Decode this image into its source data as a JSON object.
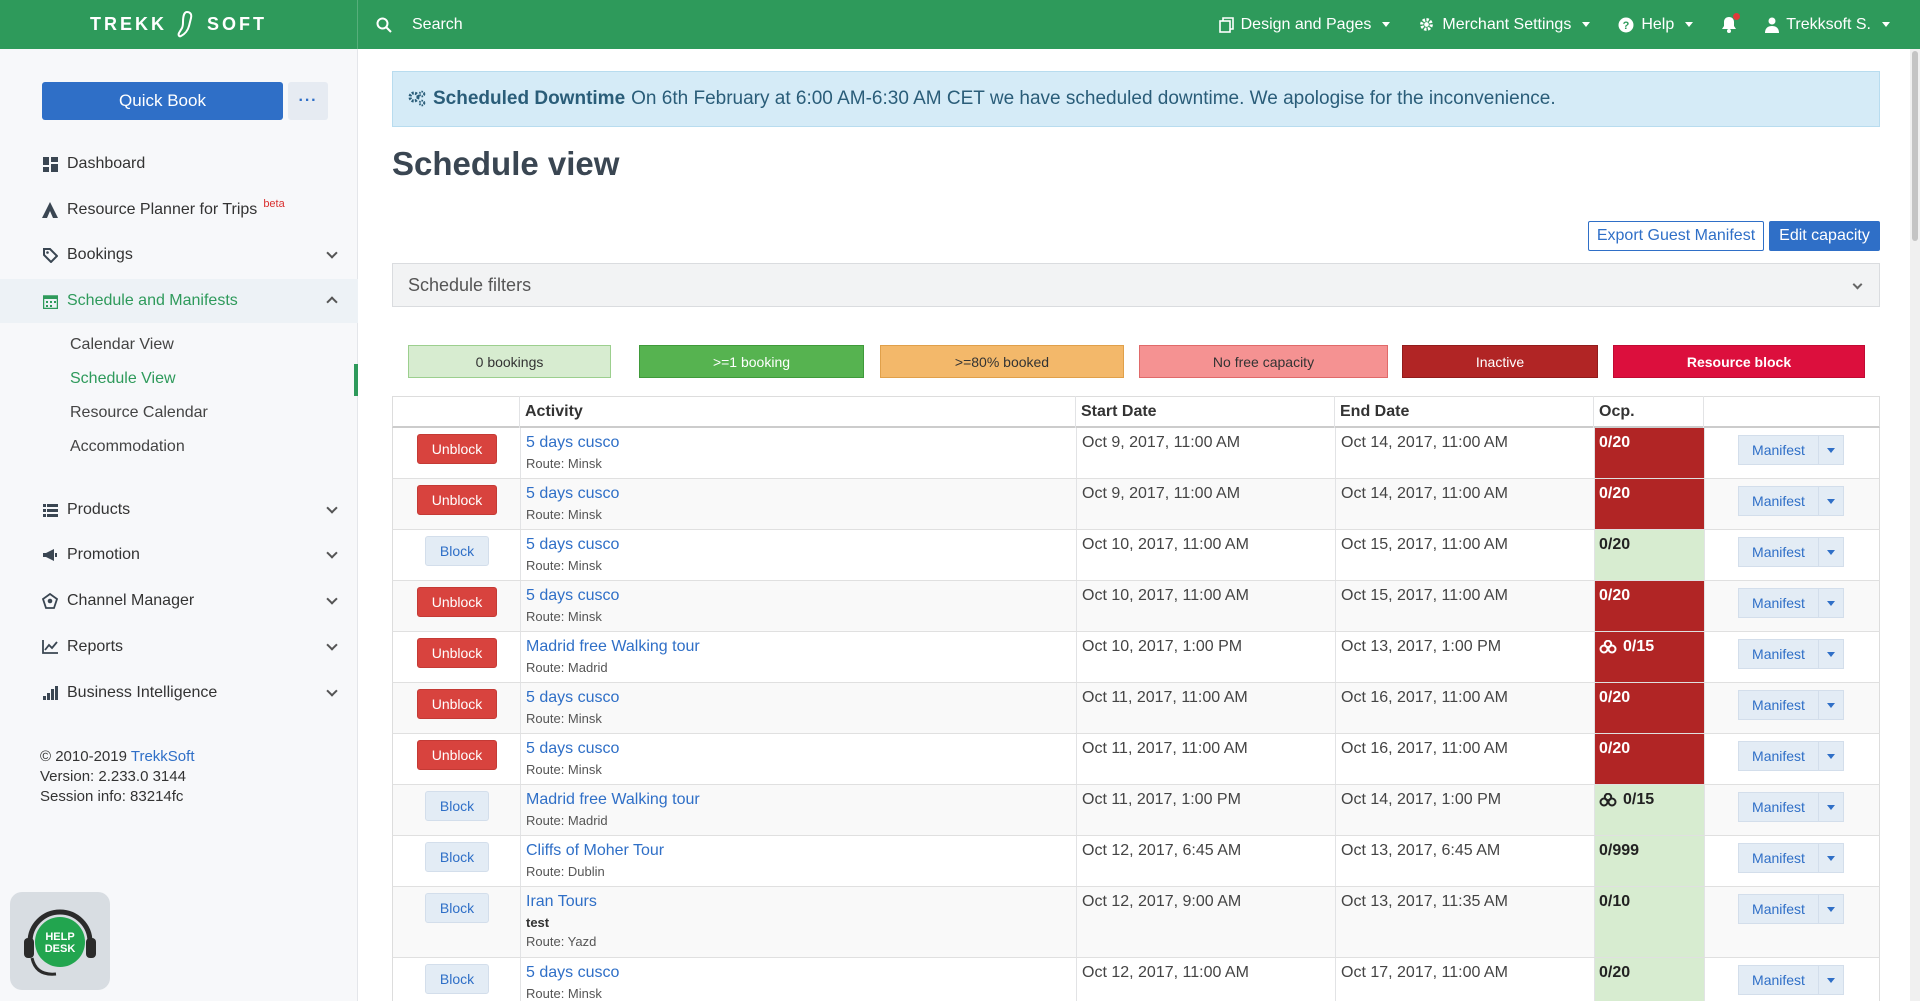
{
  "topbar": {
    "logo_left": "TREKK",
    "logo_right": "SOFT",
    "search_label": "Search",
    "nav": [
      {
        "label": "Design and Pages",
        "icon": "copy-icon"
      },
      {
        "label": "Merchant Settings",
        "icon": "gear-icon"
      },
      {
        "label": "Help",
        "icon": "question-icon"
      },
      {
        "label": "",
        "icon": "bell-icon"
      },
      {
        "label": "Trekksoft S.",
        "icon": "user-icon"
      }
    ]
  },
  "sidebar": {
    "quick_book": "Quick Book",
    "more_label": "···",
    "items": [
      {
        "label": "Dashboard",
        "icon": "dashboard-icon"
      },
      {
        "label": "Resource Planner for Trips",
        "icon": "planner-icon",
        "badge": "beta"
      },
      {
        "label": "Bookings",
        "icon": "tag-icon"
      },
      {
        "label": "Schedule and Manifests",
        "icon": "calendar-icon"
      },
      {
        "label": "Products",
        "icon": "list-icon"
      },
      {
        "label": "Promotion",
        "icon": "megaphone-icon"
      },
      {
        "label": "Channel Manager",
        "icon": "network-icon"
      },
      {
        "label": "Reports",
        "icon": "chart-icon"
      },
      {
        "label": "Business Intelligence",
        "icon": "bars-icon"
      }
    ],
    "subitems": [
      "Calendar View",
      "Schedule View",
      "Resource Calendar",
      "Accommodation"
    ],
    "footer": {
      "copyright": "© 2010-2019 ",
      "company": "TrekkSoft",
      "version": "Version: 2.233.0 3144",
      "session": "Session info: 83214fc"
    },
    "help_desk": "HELP DESK"
  },
  "alert": {
    "title": "Scheduled Downtime",
    "text": "On 6th February at 6:00 AM-6:30 AM CET we have scheduled downtime. We apologise for the inconvenience."
  },
  "page_title": "Schedule view",
  "actions": {
    "export": "Export Guest Manifest",
    "edit": "Edit capacity"
  },
  "filters_label": "Schedule filters",
  "legend": [
    {
      "label": "0 bookings",
      "bg": "#d7ecd0",
      "border": "#9ccf8e",
      "color": "#333",
      "bold": false
    },
    {
      "label": ">=1 booking",
      "bg": "#56b350",
      "border": "#3f9a3a",
      "color": "#fff",
      "bold": false
    },
    {
      "label": ">=80% booked",
      "bg": "#f3b86a",
      "border": "#e0a04a",
      "color": "#333",
      "bold": false
    },
    {
      "label": "No free capacity",
      "bg": "#f59292",
      "border": "#e06a6a",
      "color": "#333",
      "bold": false
    },
    {
      "label": "Inactive",
      "bg": "#b12525",
      "border": "#911c1c",
      "color": "#fff",
      "bold": false
    },
    {
      "label": "Resource block",
      "bg": "#dc0f3d",
      "border": "#c00b33",
      "color": "#fff",
      "bold": true
    }
  ],
  "table": {
    "headers": [
      "",
      "Activity",
      "Start Date",
      "End Date",
      "Ocp.",
      ""
    ],
    "manifest_label": "Manifest",
    "rows": [
      {
        "button": "Unblock",
        "activity": "5 days cusco",
        "extra": "",
        "route": "Route: Minsk",
        "start": "Oct 9, 2017, 11:00 AM",
        "end": "Oct 14, 2017, 11:00 AM",
        "ocp": "0/20",
        "status": "inactive",
        "icon": false
      },
      {
        "button": "Unblock",
        "activity": "5 days cusco",
        "extra": "",
        "route": "Route: Minsk",
        "start": "Oct 9, 2017, 11:00 AM",
        "end": "Oct 14, 2017, 11:00 AM",
        "ocp": "0/20",
        "status": "inactive",
        "icon": false
      },
      {
        "button": "Block",
        "activity": "5 days cusco",
        "extra": "",
        "route": "Route: Minsk",
        "start": "Oct 10, 2017, 11:00 AM",
        "end": "Oct 15, 2017, 11:00 AM",
        "ocp": "0/20",
        "status": "empty",
        "icon": false
      },
      {
        "button": "Unblock",
        "activity": "5 days cusco",
        "extra": "",
        "route": "Route: Minsk",
        "start": "Oct 10, 2017, 11:00 AM",
        "end": "Oct 15, 2017, 11:00 AM",
        "ocp": "0/20",
        "status": "inactive",
        "icon": false
      },
      {
        "button": "Unblock",
        "activity": "Madrid free Walking tour",
        "extra": "",
        "route": "Route: Madrid",
        "start": "Oct 10, 2017, 1:00 PM",
        "end": "Oct 13, 2017, 1:00 PM",
        "ocp": "0/15",
        "status": "inactive",
        "icon": true
      },
      {
        "button": "Unblock",
        "activity": "5 days cusco",
        "extra": "",
        "route": "Route: Minsk",
        "start": "Oct 11, 2017, 11:00 AM",
        "end": "Oct 16, 2017, 11:00 AM",
        "ocp": "0/20",
        "status": "inactive",
        "icon": false
      },
      {
        "button": "Unblock",
        "activity": "5 days cusco",
        "extra": "",
        "route": "Route: Minsk",
        "start": "Oct 11, 2017, 11:00 AM",
        "end": "Oct 16, 2017, 11:00 AM",
        "ocp": "0/20",
        "status": "inactive",
        "icon": false
      },
      {
        "button": "Block",
        "activity": "Madrid free Walking tour",
        "extra": "",
        "route": "Route: Madrid",
        "start": "Oct 11, 2017, 1:00 PM",
        "end": "Oct 14, 2017, 1:00 PM",
        "ocp": "0/15",
        "status": "empty",
        "icon": true
      },
      {
        "button": "Block",
        "activity": "Cliffs of Moher Tour",
        "extra": "",
        "route": "Route: Dublin",
        "start": "Oct 12, 2017, 6:45 AM",
        "end": "Oct 13, 2017, 6:45 AM",
        "ocp": "0/999",
        "status": "empty",
        "icon": false
      },
      {
        "button": "Block",
        "activity": "Iran Tours",
        "extra": "test",
        "route": "Route: Yazd",
        "start": "Oct 12, 2017, 9:00 AM",
        "end": "Oct 13, 2017, 11:35 AM",
        "ocp": "0/10",
        "status": "empty",
        "icon": false
      },
      {
        "button": "Block",
        "activity": "5 days cusco",
        "extra": "",
        "route": "Route: Minsk",
        "start": "Oct 12, 2017, 11:00 AM",
        "end": "Oct 17, 2017, 11:00 AM",
        "ocp": "0/20",
        "status": "empty",
        "icon": false
      }
    ]
  },
  "colors": {
    "brand_green": "#2e9a5b",
    "primary_blue": "#2f6fc7",
    "inactive": "#b12525",
    "empty": "#d7ecd0"
  }
}
